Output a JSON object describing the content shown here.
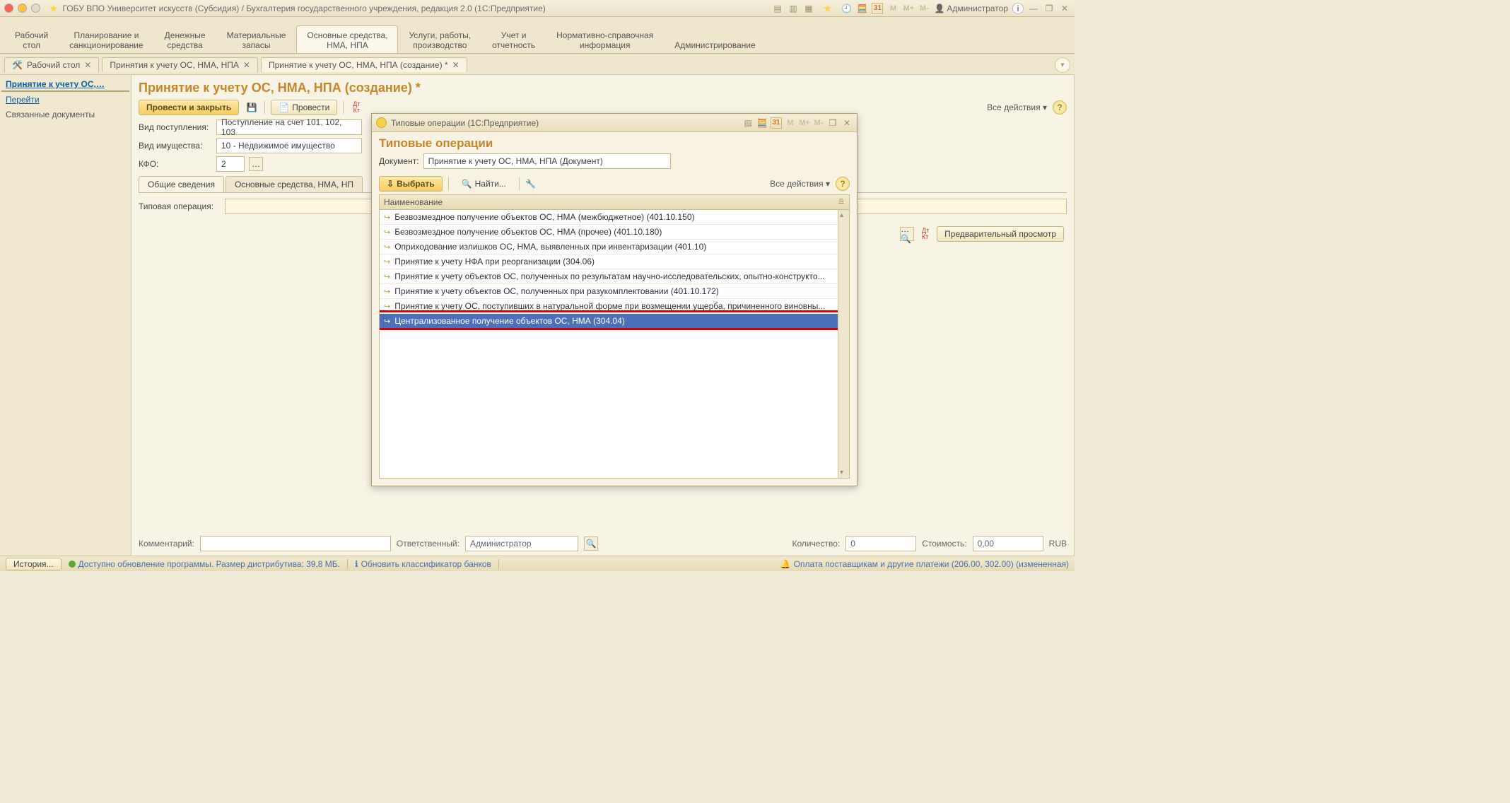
{
  "title": "ГОБУ ВПО Университет искусств (Субсидия) / Бухгалтерия государственного учреждения, редакция 2.0  (1С:Предприятие)",
  "user": "Администратор",
  "mem_buttons": [
    "M",
    "M+",
    "M-"
  ],
  "sections": [
    "Рабочий\nстол",
    "Планирование и\nсанкционирование",
    "Денежные\nсредства",
    "Материальные\nзапасы",
    "Основные средства,\nНМА, НПА",
    "Услуги, работы,\nпроизводство",
    "Учет и\nотчетность",
    "Нормативно-справочная\nинформация",
    "Администрирование"
  ],
  "active_section_index": 4,
  "doctabs": [
    {
      "icon": "🛠️",
      "label": "Рабочий стол",
      "close": true
    },
    {
      "icon": "",
      "label": "Принятия к учету ОС, НМА, НПА",
      "close": true
    },
    {
      "icon": "",
      "label": "Принятие к учету ОС, НМА, НПА (создание) *",
      "close": true,
      "active": true
    }
  ],
  "side": {
    "title": "Принятие к учету ОС,…",
    "link": "Перейти",
    "sub": "Связанные документы"
  },
  "page_title": "Принятие к учету ОС, НМА, НПА (создание) *",
  "toolbar": {
    "post_close": "Провести и закрыть",
    "post": "Провести",
    "dtkt": "Дт\nКт",
    "all_actions": "Все действия ▾"
  },
  "form": {
    "l1": "Вид поступления:",
    "v1": "Поступление на счет 101, 102, 103",
    "l2": "Вид имущества:",
    "v2": "10 - Недвижимое имущество",
    "l3": "КФО:",
    "v3": "2"
  },
  "inner_tabs": [
    "Общие сведения",
    "Основные средства, НМА, НП"
  ],
  "typed": {
    "label": "Типовая операция:",
    "value": ""
  },
  "preview": "Предварительный просмотр",
  "footer": {
    "qty_lbl": "Количество:",
    "qty": "0",
    "cost_lbl": "Стоимость:",
    "cost": "0,00",
    "cur": "RUB",
    "comment_lbl": "Комментарий:",
    "resp_lbl": "Ответственный:",
    "resp_val": "Администратор"
  },
  "modal": {
    "wintitle": "Типовые операции  (1С:Предприятие)",
    "mem": [
      "M",
      "M+",
      "M-"
    ],
    "head": "Типовые операции",
    "doc_lbl": "Документ:",
    "doc_val": "Принятие к учету ОС, НМА, НПА (Документ)",
    "select": "Выбрать",
    "find": "Найти...",
    "all_actions": "Все действия ▾",
    "col": "Наименование",
    "items": [
      "Безвозмездное получение объектов ОС, НМА (межбюджетное) (401.10.150)",
      "Безвозмездное получение объектов ОС, НМА (прочее) (401.10.180)",
      "Оприходование излишков ОС, НМА, выявленных при инвентаризации (401.10)",
      "Принятие к учету НФА при реорганизации (304.06)",
      "Принятие к учету объектов ОС, полученных по результатам научно-исследовательских, опытно-конструкто...",
      "Принятие к учету объектов ОС, полученных при разукомплектовании (401.10.172)",
      "Принятие к учету ОС, поступивших в натуральной форме при возмещении ущерба, причиненного виновны...",
      "Централизованное получение объектов ОС, НМА (304.04)"
    ],
    "selected_index": 7
  },
  "status": {
    "history": "История...",
    "update": "Доступно обновление программы. Размер дистрибутива: 39,8 МБ.",
    "banks": "Обновить классификатор банков",
    "pay": "Оплата поставщикам и другие платежи (206.00, 302.00) (измененная)"
  }
}
